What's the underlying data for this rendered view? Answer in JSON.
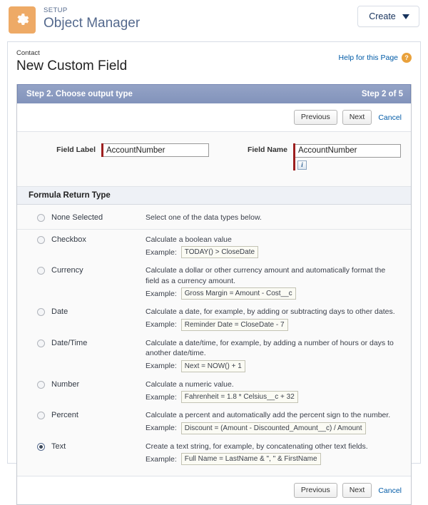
{
  "setup": {
    "eyebrow": "SETUP",
    "title": "Object Manager",
    "icon": "gear-icon",
    "icon_color": "#eeaa66",
    "create_label": "Create"
  },
  "page": {
    "breadcrumb": "Contact",
    "title": "New Custom Field",
    "help_label": "Help for this Page",
    "help_badge": "?"
  },
  "wizard": {
    "step_title": "Step 2. Choose output type",
    "step_counter": "Step 2 of 5",
    "header_color": "#8a9ac1",
    "buttons": {
      "previous": "Previous",
      "next": "Next",
      "cancel": "Cancel"
    }
  },
  "fields": {
    "label_caption": "Field Label",
    "label_value": "AccountNumber",
    "name_caption": "Field Name",
    "name_value": "AccountNumber",
    "info_icon_glyph": "i",
    "required_color": "#9d1f1f"
  },
  "formula_section": {
    "heading": "Formula Return Type",
    "options": [
      {
        "id": "none-selected",
        "label": "None Selected",
        "selected": false,
        "description": "Select one of the data types below.",
        "example_word": "",
        "example": ""
      },
      {
        "id": "checkbox",
        "label": "Checkbox",
        "selected": false,
        "description": "Calculate a boolean value",
        "example_word": "Example:",
        "example": "TODAY() > CloseDate"
      },
      {
        "id": "currency",
        "label": "Currency",
        "selected": false,
        "description": "Calculate a dollar or other currency amount and automatically format the field as a currency amount.",
        "example_word": "Example:",
        "example": "Gross Margin = Amount - Cost__c"
      },
      {
        "id": "date",
        "label": "Date",
        "selected": false,
        "description": "Calculate a date, for example, by adding or subtracting days to other dates.",
        "example_word": "Example:",
        "example": "Reminder Date = CloseDate - 7"
      },
      {
        "id": "date-time",
        "label": "Date/Time",
        "selected": false,
        "description": "Calculate a date/time, for example, by adding a number of hours or days to another date/time.",
        "example_word": "Example:",
        "example": "Next = NOW() + 1"
      },
      {
        "id": "number",
        "label": "Number",
        "selected": false,
        "description": "Calculate a numeric value.",
        "example_word": "Example:",
        "example": "Fahrenheit = 1.8 * Celsius__c + 32"
      },
      {
        "id": "percent",
        "label": "Percent",
        "selected": false,
        "description": "Calculate a percent and automatically add the percent sign to the number.",
        "example_word": "Example:",
        "example": "Discount = (Amount - Discounted_Amount__c) / Amount"
      },
      {
        "id": "text",
        "label": "Text",
        "selected": true,
        "description": "Create a text string, for example, by concatenating other text fields.",
        "example_word": "Example:",
        "example": "Full Name = LastName & \", \" & FirstName"
      }
    ]
  }
}
